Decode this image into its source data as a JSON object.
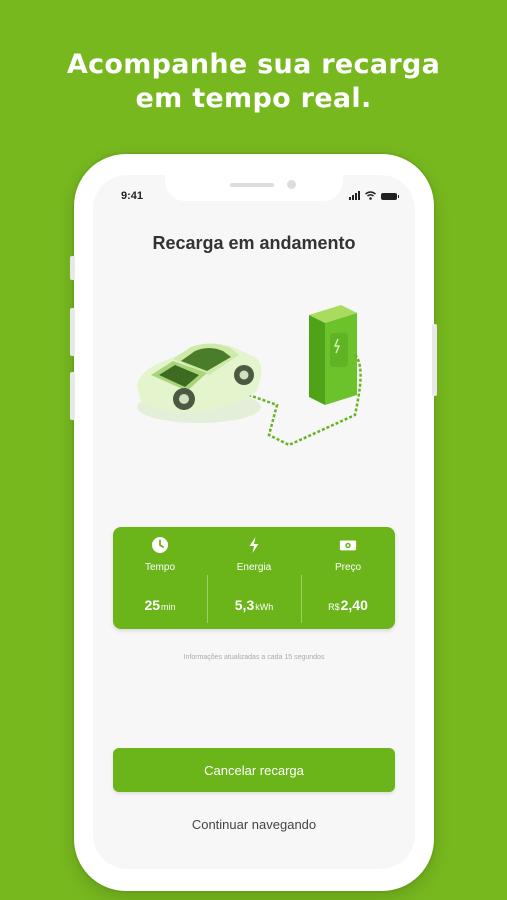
{
  "headline": [
    "Acompanhe sua recarga",
    "em tempo real."
  ],
  "status_bar": {
    "time": "9:41"
  },
  "screen": {
    "title": "Recarga em andamento",
    "stats": [
      {
        "icon": "clock-icon",
        "label": "Tempo",
        "value": "25",
        "unit": "min",
        "prefix": ""
      },
      {
        "icon": "lightning-icon",
        "label": "Energia",
        "value": "5,3",
        "unit": "kWh",
        "prefix": ""
      },
      {
        "icon": "money-icon",
        "label": "Preço",
        "value": "2,40",
        "unit": "",
        "prefix": "R$"
      }
    ],
    "info_note": "Informações atualizadas a cada 15 segundos",
    "cancel_button": "Cancelar recarga",
    "continue_link": "Continuar navegando"
  },
  "colors": {
    "background": "#77b81f",
    "accent": "#6bb51a"
  }
}
